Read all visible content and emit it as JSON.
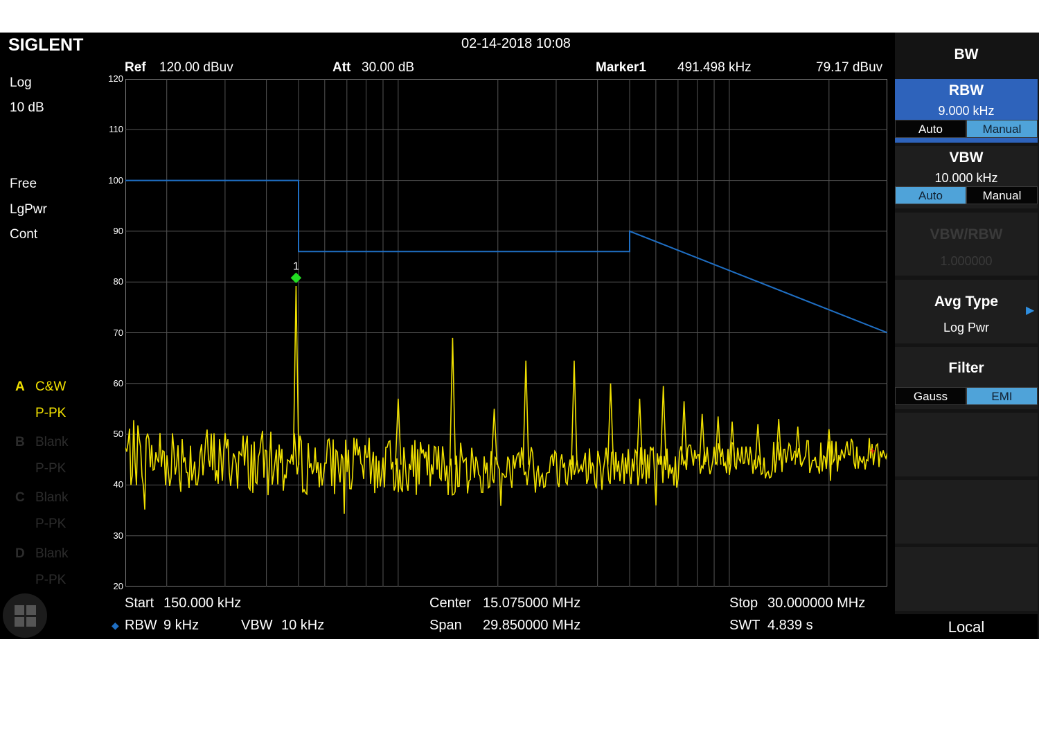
{
  "brand": "SIGLENT",
  "datetime": "02-14-2018 10:08",
  "header": {
    "ref_label": "Ref",
    "ref_value": "120.00 dBuv",
    "att_label": "Att",
    "att_value": "30.00 dB",
    "marker_label": "Marker1",
    "marker_freq": "491.498 kHz",
    "marker_level": "79.17 dBuv"
  },
  "left_info": {
    "scale_type": "Log",
    "scale_div": "10 dB",
    "trigger": "Free",
    "detector_avg": "LgPwr",
    "sweep_mode": "Cont"
  },
  "traces": [
    {
      "letter": "A",
      "state": "C&W",
      "detector": "P-PK",
      "active": true
    },
    {
      "letter": "B",
      "state": "Blank",
      "detector": "P-PK",
      "active": false
    },
    {
      "letter": "C",
      "state": "Blank",
      "detector": "P-PK",
      "active": false
    },
    {
      "letter": "D",
      "state": "Blank",
      "detector": "P-PK",
      "active": false
    }
  ],
  "footer": {
    "start_label": "Start",
    "start_value": "150.000 kHz",
    "center_label": "Center",
    "center_value": "15.075000 MHz",
    "stop_label": "Stop",
    "stop_value": "30.000000 MHz",
    "rbw_label": "RBW",
    "rbw_value": "9 kHz",
    "vbw_label": "VBW",
    "vbw_value": "10 kHz",
    "span_label": "Span",
    "span_value": "29.850000 MHz",
    "swt_label": "SWT",
    "swt_value": "4.839 s"
  },
  "sidebar": {
    "title": "BW",
    "rbw": {
      "label": "RBW",
      "value": "9.000 kHz",
      "opt_auto": "Auto",
      "opt_manual": "Manual",
      "selected": "Manual"
    },
    "vbw": {
      "label": "VBW",
      "value": "10.000 kHz",
      "opt_auto": "Auto",
      "opt_manual": "Manual",
      "selected": "Auto"
    },
    "ratio": {
      "label": "VBW/RBW",
      "value": "1.000000",
      "enabled": false
    },
    "avg_type": {
      "label": "Avg Type",
      "value": "Log Pwr"
    },
    "filter": {
      "label": "Filter",
      "opt_gauss": "Gauss",
      "opt_emi": "EMI",
      "selected": "EMI"
    },
    "local": "Local"
  },
  "colors": {
    "trace": "#f0e000",
    "limit_line": "#1f6fc4",
    "marker": "#22dd22",
    "accent": "#4fa3d9",
    "grid": "#555555"
  },
  "chart_data": {
    "type": "line",
    "x_scale": "log",
    "xlim_hz": [
      150000,
      30000000
    ],
    "ylim": [
      20,
      120
    ],
    "y_ticks": [
      120,
      110,
      100,
      90,
      80,
      70,
      60,
      50,
      40,
      30,
      20
    ],
    "y_unit": "dBuv",
    "grid": true,
    "marker": {
      "label": "1",
      "freq_hz": 491498,
      "level": 79.17
    },
    "limit_line": [
      {
        "f": 150000,
        "y": 100
      },
      {
        "f": 500000,
        "y": 100
      },
      {
        "f": 500000,
        "y": 86
      },
      {
        "f": 5000000,
        "y": 86
      },
      {
        "f": 5000000,
        "y": 90
      },
      {
        "f": 30000000,
        "y": 70
      }
    ],
    "peaks": [
      {
        "f": 491498,
        "y": 79.2
      },
      {
        "f": 1460000,
        "y": 69
      },
      {
        "f": 2430000,
        "y": 64.5
      },
      {
        "f": 3400000,
        "y": 64.5
      },
      {
        "f": 1950000,
        "y": 55
      },
      {
        "f": 1000000,
        "y": 57
      },
      {
        "f": 4380000,
        "y": 60
      },
      {
        "f": 5360000,
        "y": 57
      },
      {
        "f": 6320000,
        "y": 59.5
      },
      {
        "f": 7300000,
        "y": 56.5
      },
      {
        "f": 8280000,
        "y": 54
      },
      {
        "f": 9250000,
        "y": 53.5
      },
      {
        "f": 10200000,
        "y": 52.5
      },
      {
        "f": 12200000,
        "y": 52
      },
      {
        "f": 14100000,
        "y": 53
      },
      {
        "f": 16100000,
        "y": 51.5
      },
      {
        "f": 20000000,
        "y": 51
      }
    ]
  }
}
